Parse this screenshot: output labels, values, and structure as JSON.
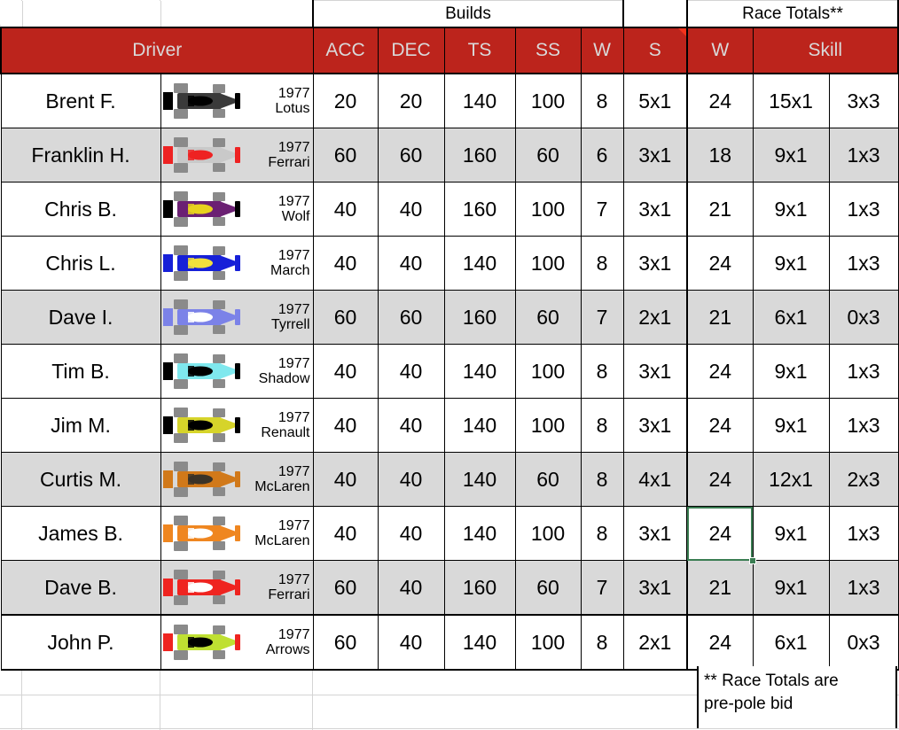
{
  "group_headers": {
    "builds": "Builds",
    "race_totals": "Race Totals**"
  },
  "columns": {
    "driver": "Driver",
    "acc": "ACC",
    "dec": "DEC",
    "ts": "TS",
    "ss": "SS",
    "w": "W",
    "s": "S",
    "rt_w": "W",
    "skill": "Skill"
  },
  "colors": {
    "header_bg": "#bc241c",
    "header_text": "#d9d9d9",
    "alt_row_bg": "#d9d9d9",
    "selection": "#3a7d52",
    "note_flag": "#f4331c",
    "gridline": "#d4d4d4"
  },
  "footnote": {
    "line1": "** Race Totals are",
    "line2": "pre-pole bid"
  },
  "rows": [
    {
      "driver": "Brent F.",
      "year": "1977",
      "team": "Lotus",
      "car": {
        "body": "#3a3a3a",
        "accent": "#000000",
        "wing": "#000000",
        "wheel": "#8a8a8a"
      },
      "acc": "20",
      "dec": "20",
      "ts": "140",
      "ss": "100",
      "w": "8",
      "s": "5x1",
      "rt_w": "24",
      "skill_a": "15x1",
      "skill_b": "3x3",
      "shaded": false
    },
    {
      "driver": "Franklin H.",
      "year": "1977",
      "team": "Ferrari",
      "car": {
        "body": "#c9c9c9",
        "accent": "#ee2222",
        "wing": "#ee2222",
        "wheel": "#8a8a8a"
      },
      "acc": "60",
      "dec": "60",
      "ts": "160",
      "ss": "60",
      "w": "6",
      "s": "3x1",
      "rt_w": "18",
      "skill_a": "9x1",
      "skill_b": "1x3",
      "shaded": true
    },
    {
      "driver": "Chris B.",
      "year": "1977",
      "team": "Wolf",
      "car": {
        "body": "#6b2073",
        "accent": "#e8d21e",
        "wing": "#000000",
        "wheel": "#8a8a8a"
      },
      "acc": "40",
      "dec": "40",
      "ts": "160",
      "ss": "100",
      "w": "7",
      "s": "3x1",
      "rt_w": "21",
      "skill_a": "9x1",
      "skill_b": "1x3",
      "shaded": false
    },
    {
      "driver": "Chris L.",
      "year": "1977",
      "team": "March",
      "car": {
        "body": "#1620d8",
        "accent": "#f2e03c",
        "wing": "#1620d8",
        "wheel": "#8a8a8a"
      },
      "acc": "40",
      "dec": "40",
      "ts": "140",
      "ss": "100",
      "w": "8",
      "s": "3x1",
      "rt_w": "24",
      "skill_a": "9x1",
      "skill_b": "1x3",
      "shaded": false
    },
    {
      "driver": "Dave I.",
      "year": "1977",
      "team": "Tyrrell",
      "car": {
        "body": "#7b82e8",
        "accent": "#ffffff",
        "wing": "#7b82e8",
        "wheel": "#8a8a8a"
      },
      "acc": "60",
      "dec": "60",
      "ts": "160",
      "ss": "60",
      "w": "7",
      "s": "2x1",
      "rt_w": "21",
      "skill_a": "6x1",
      "skill_b": "0x3",
      "shaded": true
    },
    {
      "driver": "Tim B.",
      "year": "1977",
      "team": "Shadow",
      "car": {
        "body": "#7fe8ee",
        "accent": "#000000",
        "wing": "#000000",
        "wheel": "#8a8a8a"
      },
      "acc": "40",
      "dec": "40",
      "ts": "140",
      "ss": "100",
      "w": "8",
      "s": "3x1",
      "rt_w": "24",
      "skill_a": "9x1",
      "skill_b": "1x3",
      "shaded": false
    },
    {
      "driver": "Jim M.",
      "year": "1977",
      "team": "Renault",
      "car": {
        "body": "#d6d42a",
        "accent": "#000000",
        "wing": "#000000",
        "wheel": "#8a8a8a"
      },
      "acc": "40",
      "dec": "40",
      "ts": "140",
      "ss": "100",
      "w": "8",
      "s": "3x1",
      "rt_w": "24",
      "skill_a": "9x1",
      "skill_b": "1x3",
      "shaded": false
    },
    {
      "driver": "Curtis M.",
      "year": "1977",
      "team": "McLaren",
      "car": {
        "body": "#d1791a",
        "accent": "#3a3328",
        "wing": "#d1791a",
        "wheel": "#8a8a8a"
      },
      "acc": "40",
      "dec": "40",
      "ts": "140",
      "ss": "60",
      "w": "8",
      "s": "4x1",
      "rt_w": "24",
      "skill_a": "12x1",
      "skill_b": "2x3",
      "shaded": true
    },
    {
      "driver": "James B.",
      "year": "1977",
      "team": "McLaren",
      "car": {
        "body": "#ef8620",
        "accent": "#ffffff",
        "wing": "#ef8620",
        "wheel": "#8a8a8a"
      },
      "acc": "40",
      "dec": "40",
      "ts": "140",
      "ss": "100",
      "w": "8",
      "s": "3x1",
      "rt_w": "24",
      "skill_a": "9x1",
      "skill_b": "1x3",
      "shaded": false
    },
    {
      "driver": "Dave B.",
      "year": "1977",
      "team": "Ferrari",
      "car": {
        "body": "#ef2420",
        "accent": "#ffffff",
        "wing": "#ef2420",
        "wheel": "#8a8a8a"
      },
      "acc": "60",
      "dec": "40",
      "ts": "160",
      "ss": "60",
      "w": "7",
      "s": "3x1",
      "rt_w": "21",
      "skill_a": "9x1",
      "skill_b": "1x3",
      "shaded": true
    },
    {
      "driver": "John P.",
      "year": "1977",
      "team": "Arrows",
      "car": {
        "body": "#bfe032",
        "accent": "#000000",
        "wing": "#ef2420",
        "wheel": "#8a8a8a"
      },
      "acc": "60",
      "dec": "40",
      "ts": "140",
      "ss": "100",
      "w": "8",
      "s": "2x1",
      "rt_w": "24",
      "skill_a": "6x1",
      "skill_b": "0x3",
      "shaded": false
    }
  ],
  "selected_cell": {
    "row_index": 8,
    "column": "rt_w",
    "value": "24"
  }
}
